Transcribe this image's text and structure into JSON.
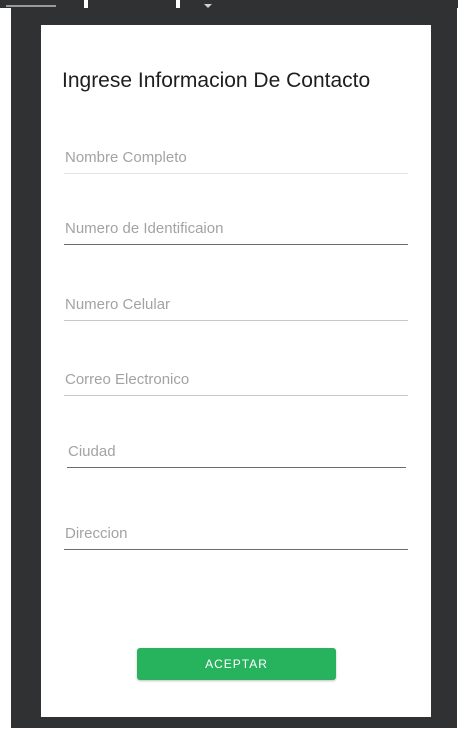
{
  "form": {
    "title": "Ingrese Informacion De Contacto",
    "fields": [
      {
        "placeholder": "Nombre Completo",
        "value": ""
      },
      {
        "placeholder": "Numero de Identificaion",
        "value": ""
      },
      {
        "placeholder": "Numero Celular",
        "value": ""
      },
      {
        "placeholder": "Correo Electronico",
        "value": ""
      },
      {
        "placeholder": "Ciudad",
        "value": ""
      },
      {
        "placeholder": "Direccion",
        "value": ""
      }
    ],
    "accept_label": "ACEPTAR"
  },
  "colors": {
    "accent": "#27b25e",
    "backdrop": "#2f3133",
    "dialog": "#ffffff"
  }
}
